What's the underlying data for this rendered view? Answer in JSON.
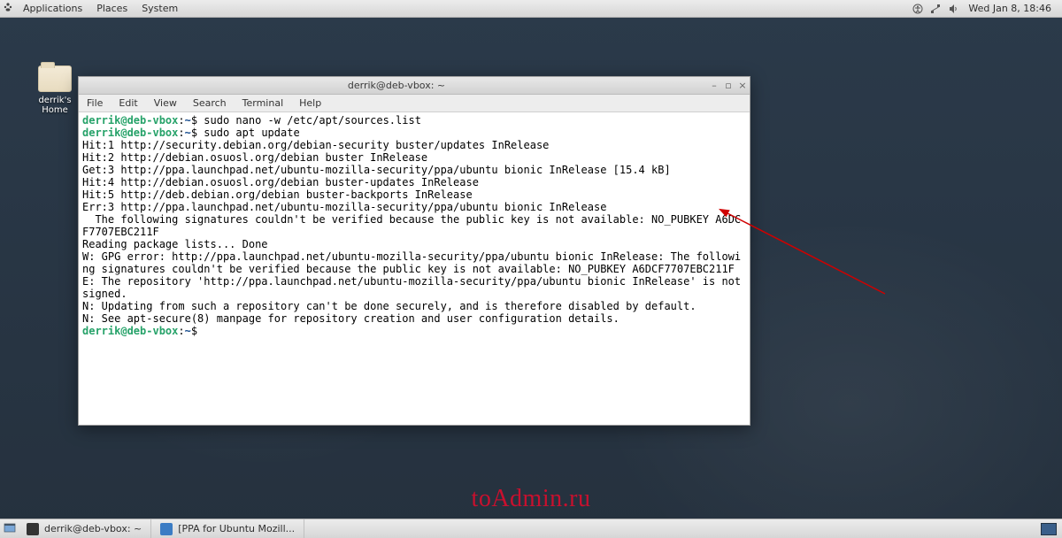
{
  "panel": {
    "menus": [
      "Applications",
      "Places",
      "System"
    ],
    "clock": "Wed Jan  8, 18:46"
  },
  "desktop": {
    "home_label": "derrik's Home"
  },
  "window": {
    "title": "derrik@deb-vbox: ~",
    "menubar": [
      "File",
      "Edit",
      "View",
      "Search",
      "Terminal",
      "Help"
    ]
  },
  "term": {
    "prompt_user": "derrik@deb-vbox",
    "prompt_path": "~",
    "cmd1": "sudo nano -w /etc/apt/sources.list",
    "cmd2": "sudo apt update",
    "l1": "Hit:1 http://security.debian.org/debian-security buster/updates InRelease",
    "l2": "Hit:2 http://debian.osuosl.org/debian buster InRelease",
    "l3": "Get:3 http://ppa.launchpad.net/ubuntu-mozilla-security/ppa/ubuntu bionic InRelease [15.4 kB]",
    "l4": "Hit:4 http://debian.osuosl.org/debian buster-updates InRelease",
    "l5": "Hit:5 http://deb.debian.org/debian buster-backports InRelease",
    "l6": "Err:3 http://ppa.launchpad.net/ubuntu-mozilla-security/ppa/ubuntu bionic InRelease",
    "l7": "  The following signatures couldn't be verified because the public key is not available: NO_PUBKEY A6DCF7707EBC211F",
    "l8": "Reading package lists... Done",
    "l9": "W: GPG error: http://ppa.launchpad.net/ubuntu-mozilla-security/ppa/ubuntu bionic InRelease: The following signatures couldn't be verified because the public key is not available: NO_PUBKEY A6DCF7707EBC211F",
    "l10": "E: The repository 'http://ppa.launchpad.net/ubuntu-mozilla-security/ppa/ubuntu bionic InRelease' is not signed.",
    "l11": "N: Updating from such a repository can't be done securely, and is therefore disabled by default.",
    "l12": "N: See apt-secure(8) manpage for repository creation and user configuration details."
  },
  "taskbar": {
    "task1": "derrik@deb-vbox: ~",
    "task2": "[PPA for Ubuntu Mozill..."
  },
  "watermark": "toAdmin.ru"
}
